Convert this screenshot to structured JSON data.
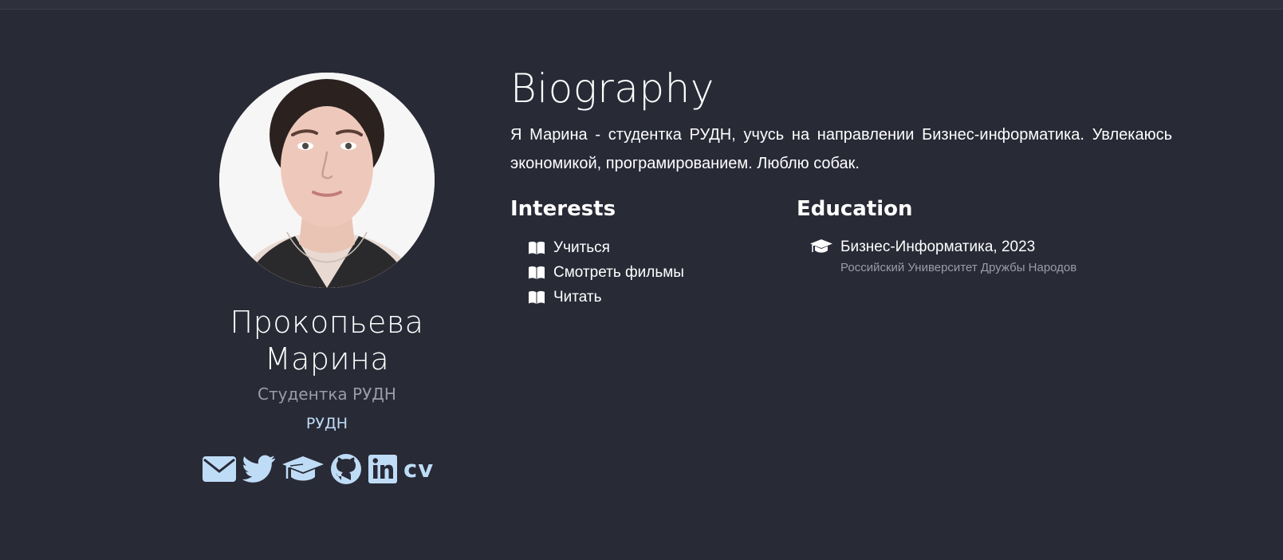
{
  "profile": {
    "name_line1": "Прокопьева",
    "name_line2": "Марина",
    "role": "Студентка РУДН",
    "organization": "РУДН",
    "socials": [
      {
        "icon": "envelope-icon"
      },
      {
        "icon": "twitter-icon"
      },
      {
        "icon": "graduation-cap-icon"
      },
      {
        "icon": "github-icon"
      },
      {
        "icon": "linkedin-icon"
      },
      {
        "icon": "cv-icon",
        "label": "cv"
      }
    ]
  },
  "biography": {
    "title": "Biography",
    "text": "Я Марина - студентка РУДН, учусь на направлении Бизнес-информатика. Увлекаюсь экономикой, програмированием. Люблю собак."
  },
  "interests": {
    "title": "Interests",
    "items": [
      "Учиться",
      "Смотреть фильмы",
      "Читать"
    ],
    "icon": "book-open-icon"
  },
  "education": {
    "title": "Education",
    "icon": "graduation-cap-icon",
    "course": "Бизнес-Информатика, 2023",
    "institution": "Российский Университет Дружбы Народов"
  },
  "colors": {
    "background": "#282a36",
    "accent": "#bfdcf7",
    "muted": "#9a9ca6"
  }
}
